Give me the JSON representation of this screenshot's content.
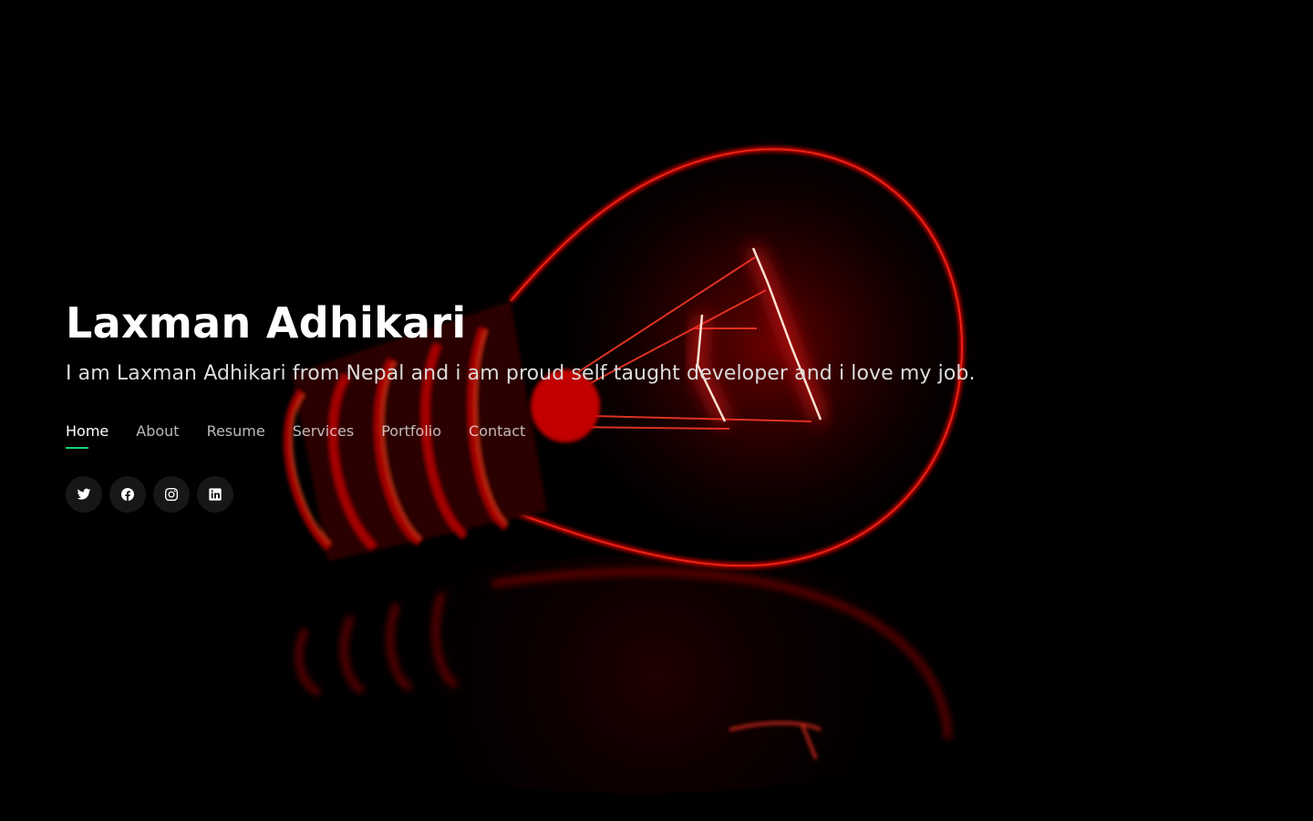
{
  "hero": {
    "name": "Laxman Adhikari",
    "tagline": "I am Laxman Adhikari from Nepal and i am proud self taught developer and i love my job."
  },
  "nav": {
    "items": [
      {
        "label": "Home",
        "active": true
      },
      {
        "label": "About",
        "active": false
      },
      {
        "label": "Resume",
        "active": false
      },
      {
        "label": "Services",
        "active": false
      },
      {
        "label": "Portfolio",
        "active": false
      },
      {
        "label": "Contact",
        "active": false
      }
    ]
  },
  "socials": [
    {
      "icon": "twitter-icon"
    },
    {
      "icon": "facebook-icon"
    },
    {
      "icon": "instagram-icon"
    },
    {
      "icon": "linkedin-icon"
    }
  ],
  "colors": {
    "background": "#000000",
    "accent": "#18d26e",
    "bulb_glow": "#e10000"
  }
}
